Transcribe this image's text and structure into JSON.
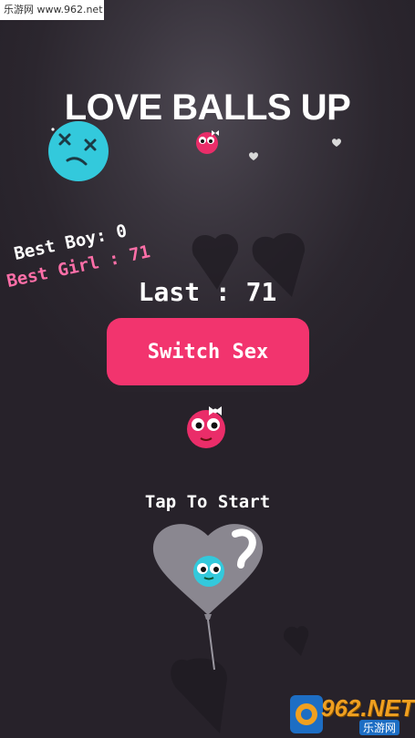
{
  "watermark_top": "乐游网 www.962.net",
  "title": "LOVE BALLS UP",
  "best_boy": "Best Boy: 0",
  "best_girl": "Best Girl : 71",
  "last": "Last : 71",
  "switch_button": "Switch Sex",
  "tap_to_start": "Tap To Start",
  "watermark_bottom": "962.NET",
  "watermark_bottom_sub": "乐游网",
  "colors": {
    "background": "#27222a",
    "accent_pink": "#f2346e",
    "girl_text": "#ff6fa8",
    "cyan_ball": "#33c9dc"
  }
}
